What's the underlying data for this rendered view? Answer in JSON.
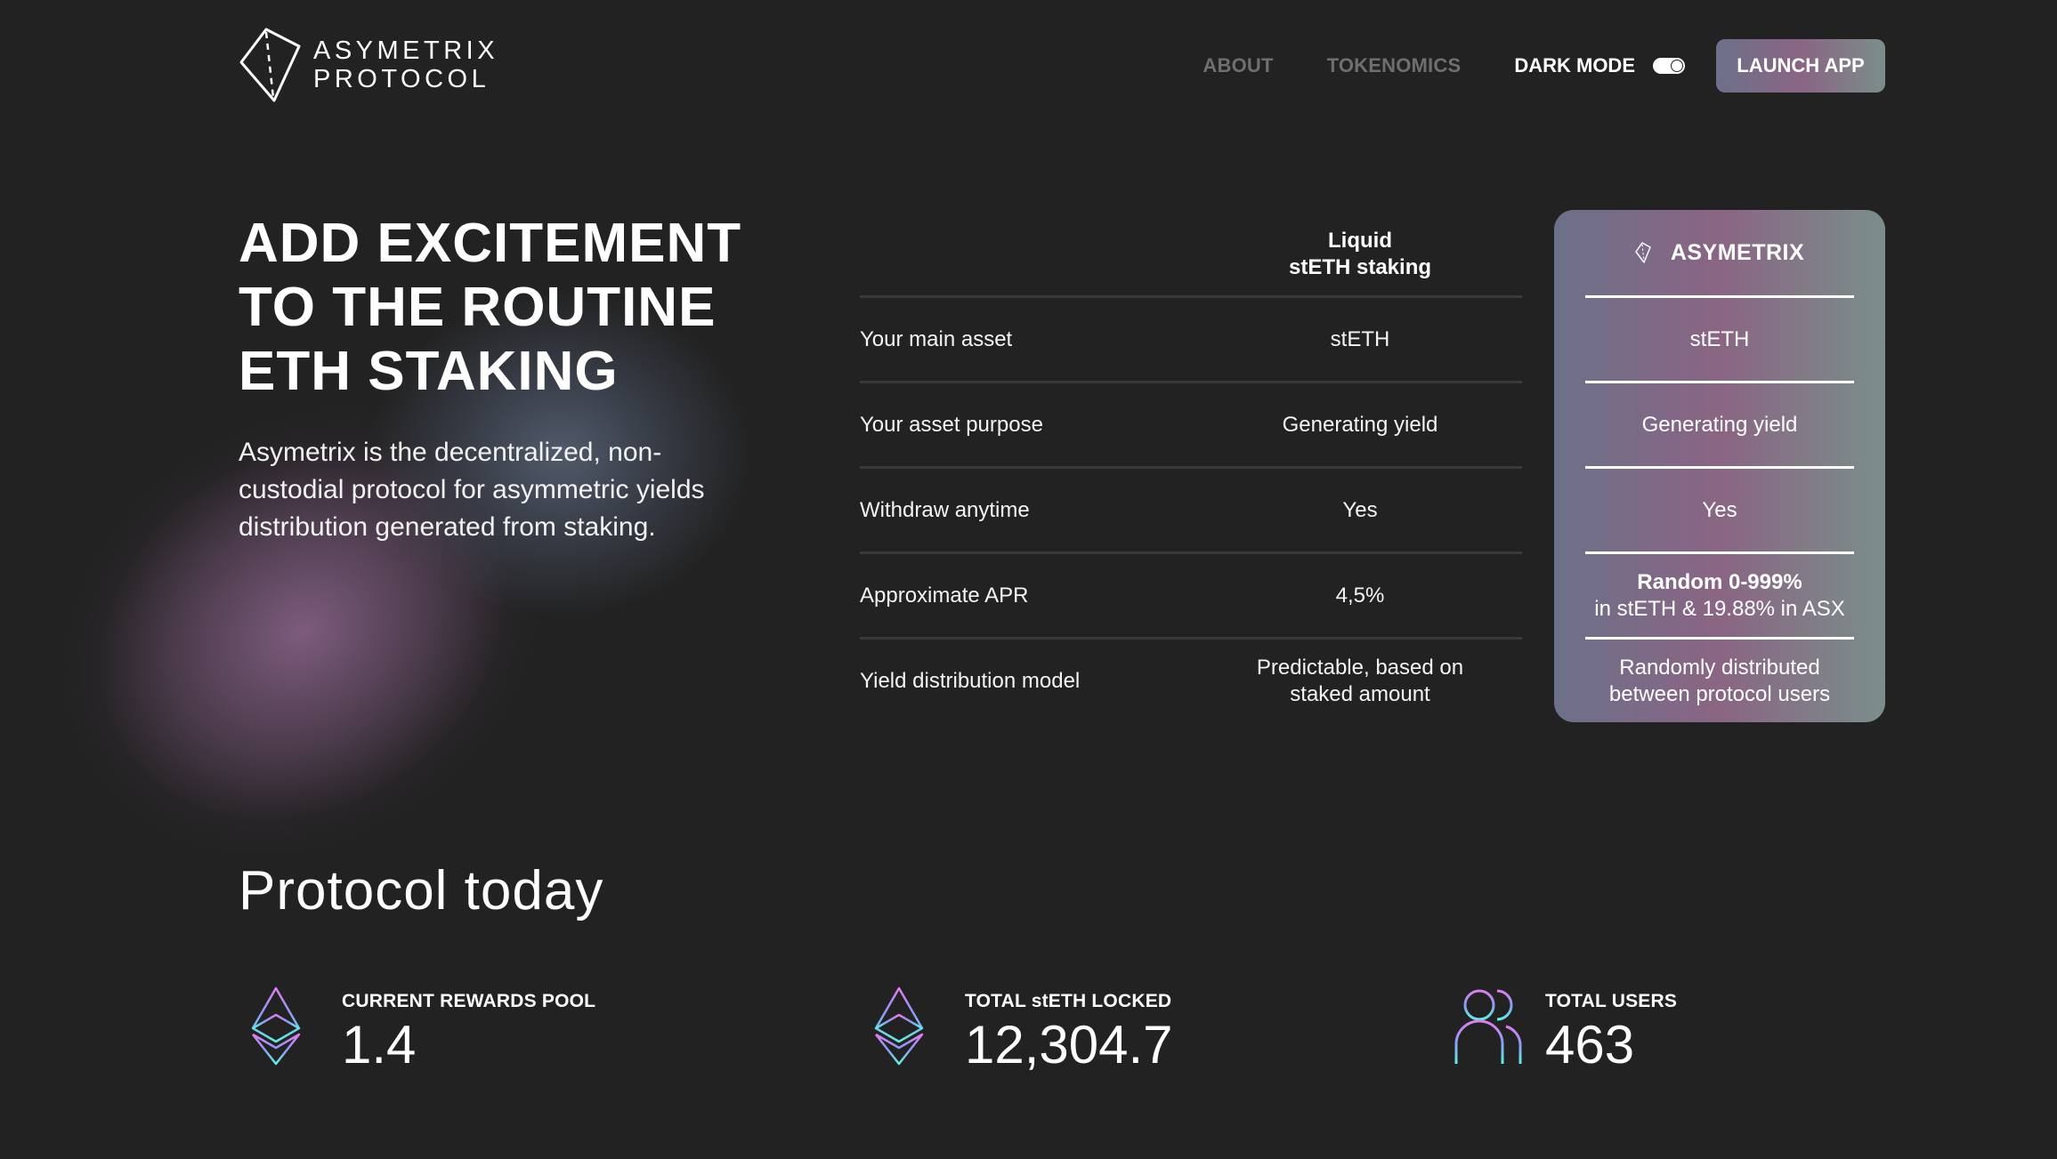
{
  "header": {
    "logo_line1": "ASYMETRIX",
    "logo_line2": "PROTOCOL",
    "logo_icon": "kite-diamond-icon",
    "nav": [
      {
        "label": "ABOUT"
      },
      {
        "label": "TOKENOMICS"
      }
    ],
    "dark_mode_label": "DARK MODE",
    "dark_mode_on": true,
    "launch_label": "LAUNCH APP"
  },
  "hero": {
    "headline_lines": [
      "ADD EXCITEMENT",
      "TO THE ROUTINE",
      "ETH STAKING"
    ],
    "description_lines": [
      "Asymetrix is the decentralized, non-",
      "custodial protocol for asymmetric yields",
      "distribution generated from staking."
    ]
  },
  "comparison": {
    "column_title_lines": [
      "Liquid",
      "stETH staking"
    ],
    "card_title": "ASYMETRIX",
    "rows": [
      {
        "label": "Your main asset",
        "liquid": [
          "stETH"
        ],
        "asymetrix_bold": "",
        "asymetrix": [
          "stETH"
        ]
      },
      {
        "label": "Your asset purpose",
        "liquid": [
          "Generating yield"
        ],
        "asymetrix_bold": "",
        "asymetrix": [
          "Generating yield"
        ]
      },
      {
        "label": "Withdraw anytime",
        "liquid": [
          "Yes"
        ],
        "asymetrix_bold": "",
        "asymetrix": [
          "Yes"
        ]
      },
      {
        "label": "Approximate APR",
        "liquid": [
          "4,5%"
        ],
        "asymetrix_bold": "Random 0-999%",
        "asymetrix": [
          "in stETH & 19.88% in ASX"
        ]
      },
      {
        "label": "Yield distribution model",
        "liquid": [
          "Predictable, based on",
          "staked amount"
        ],
        "asymetrix_bold": "",
        "asymetrix": [
          "Randomly distributed",
          "between protocol users"
        ]
      }
    ]
  },
  "stats": {
    "title": "Protocol today",
    "items": [
      {
        "icon": "ethereum-icon",
        "label": "CURRENT REWARDS POOL",
        "value": "1.4"
      },
      {
        "icon": "ethereum-icon",
        "label": "TOTAL stETH LOCKED",
        "value": "12,304.7"
      },
      {
        "icon": "users-icon",
        "label": "TOTAL USERS",
        "value": "463"
      }
    ]
  },
  "colors": {
    "background": "#222222",
    "gradient_left": "#6c7089",
    "gradient_mid": "#8a6584",
    "gradient_right": "#7a8e8a",
    "nav_muted": "#6f6f6f",
    "separator": "#3a3a3a",
    "icon_gradient_top": "#e07cf0",
    "icon_gradient_mid": "#8a9cf5",
    "icon_gradient_bottom": "#5ef0e0"
  }
}
